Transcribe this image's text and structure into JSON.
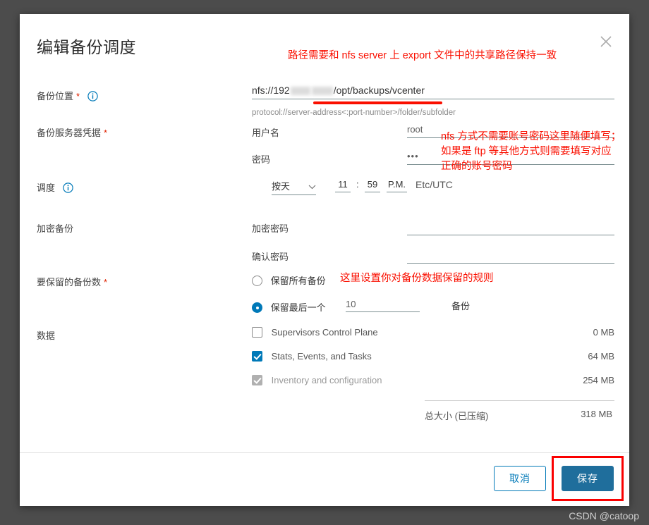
{
  "watermark": "CSDN @catoop",
  "dialog": {
    "title": "编辑备份调度",
    "close_icon": "close-icon"
  },
  "fields": {
    "location": {
      "label": "备份位置",
      "required": "*",
      "info_icon": "info-icon",
      "value_prefix": "nfs://192",
      "value_suffix": "/opt/backups/vcenter",
      "hint": "protocol://server-address<:port-number>/folder/subfolder"
    },
    "credentials": {
      "label": "备份服务器凭据",
      "required": "*",
      "username_label": "用户名",
      "username_value": "root",
      "password_label": "密码",
      "password_value": "•••"
    },
    "schedule": {
      "label": "调度",
      "info_icon": "info-icon",
      "frequency": "按天",
      "frequency_caret": "chevron-down-icon",
      "hour": "11",
      "separator": ":",
      "minute": "59",
      "meridiem": "P.M.",
      "timezone": "Etc/UTC"
    },
    "encryption": {
      "label": "加密备份",
      "password_label": "加密密码",
      "password_value": "",
      "confirm_label": "确认密码",
      "confirm_value": ""
    },
    "retention": {
      "label": "要保留的备份数",
      "required": "*",
      "option_all": "保留所有备份",
      "option_last": "保留最后一个",
      "count_value": "10",
      "count_unit": "备份"
    },
    "data": {
      "label": "数据",
      "items": [
        {
          "name": "Supervisors Control Plane",
          "size": "0 MB",
          "checked": false,
          "disabled": false
        },
        {
          "name": "Stats, Events, and Tasks",
          "size": "64 MB",
          "checked": true,
          "disabled": false
        },
        {
          "name": "Inventory and configuration",
          "size": "254 MB",
          "checked": true,
          "disabled": true
        }
      ],
      "total_label": "总大小 (已压缩)",
      "total_size": "318 MB"
    }
  },
  "annotations": {
    "path": "路径需要和 nfs server 上 export 文件中的共享路径保持一致",
    "creds_line1": "nfs 方式不需要账号密码这里随便填写；",
    "creds_line2": "如果是 ftp 等其他方式则需要填写对应",
    "creds_line3": "正确的账号密码",
    "retention": "这里设置你对备份数据保留的规则"
  },
  "footer": {
    "cancel_label": "取消",
    "save_label": "保存"
  },
  "colors": {
    "accent": "#0079b8",
    "save_button": "#1f6e9c",
    "annotation_red": "#fa0f00",
    "required_red": "#e02200",
    "backdrop": "#4c4c4c"
  }
}
